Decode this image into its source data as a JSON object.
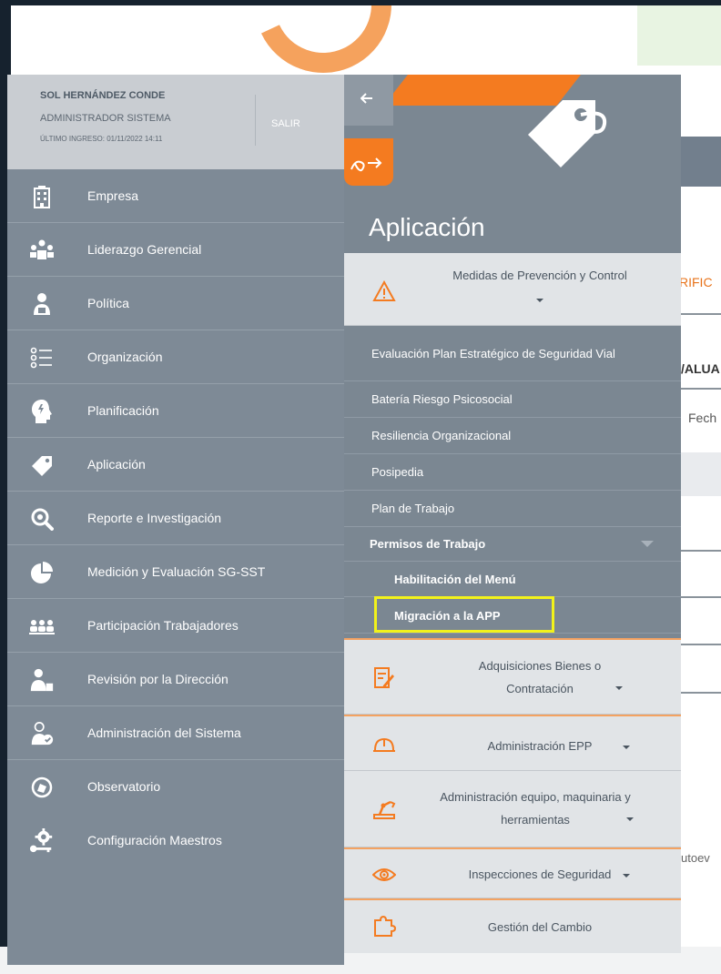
{
  "background": {
    "tab_partial": "RIFIC",
    "col_partial": "/ALUA",
    "field_partial": "Fech",
    "bottom_partial": "utoev"
  },
  "user": {
    "name": "SOL HERNÁNDEZ CONDE",
    "role": "ADMINISTRADOR SISTEMA",
    "last_login": "ÚLTIMO INGRESO: 01/11/2022 14:11",
    "logout_label": "SALIR"
  },
  "sidebar": {
    "items": [
      {
        "label": "Empresa",
        "icon": "building-icon"
      },
      {
        "label": "Liderazgo Gerencial",
        "icon": "leadership-icon"
      },
      {
        "label": "Política",
        "icon": "policy-icon"
      },
      {
        "label": "Organización",
        "icon": "org-list-icon"
      },
      {
        "label": "Planificación",
        "icon": "planning-head-icon"
      },
      {
        "label": "Aplicación",
        "icon": "tag-icon"
      },
      {
        "label": "Reporte e Investigación",
        "icon": "magnifier-icon"
      },
      {
        "label": "Medición y Evaluación SG-SST",
        "icon": "pie-chart-icon"
      },
      {
        "label": "Participación Trabajadores",
        "icon": "people-group-icon"
      },
      {
        "label": "Revisión por la Dirección",
        "icon": "director-icon"
      },
      {
        "label": "Administración del Sistema",
        "icon": "admin-user-icon"
      },
      {
        "label": "Observatorio",
        "icon": "observatory-icon"
      },
      {
        "label": "Configuración Maestros",
        "icon": "gear-key-icon"
      }
    ]
  },
  "panel": {
    "title": "Aplicación",
    "prevention": {
      "label": "Medidas de Prevención y Control"
    },
    "sub_items": [
      "Evaluación Plan Estratégico de Seguridad Vial",
      "Batería Riesgo Psicosocial",
      "Resiliencia Organizacional",
      "Posipedia",
      "Plan de Trabajo"
    ],
    "permits": {
      "label": "Permisos de Trabajo",
      "items": [
        "Habilitación del Menú",
        "Migración a la APP"
      ]
    },
    "sections": [
      {
        "label": "Adquisiciones Bienes o Contratación",
        "icon": "edit-doc-icon"
      },
      {
        "label": "Administración EPP",
        "icon": "helmet-icon"
      },
      {
        "label": "Administración equipo, maquinaria y herramientas",
        "icon": "machinery-icon"
      },
      {
        "label": "Inspecciones de Seguridad",
        "icon": "eye-icon"
      },
      {
        "label": "Gestión del Cambio",
        "icon": "puzzle-icon"
      }
    ]
  },
  "colors": {
    "sidebar_bg": "#7e8a96",
    "accent_orange": "#f47b20",
    "highlight_yellow": "#f2f21a"
  }
}
